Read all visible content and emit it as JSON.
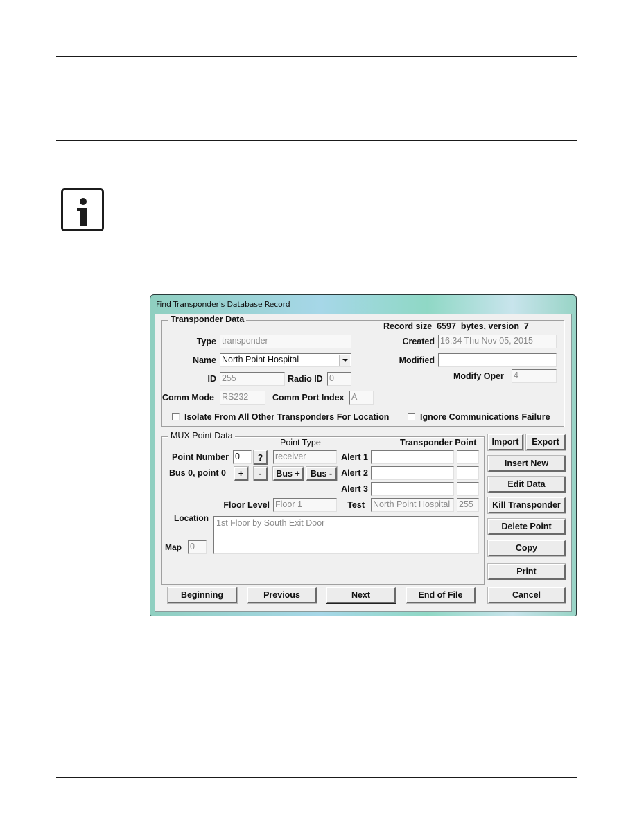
{
  "window": {
    "title": "Find Transponder's Database Record"
  },
  "transponder_data": {
    "group_title": "Transponder Data",
    "record_size_label": "Record size",
    "record_size_value": "6597",
    "bytes_version_label": "bytes, version",
    "version_value": "7",
    "type_label": "Type",
    "type_value": "transponder",
    "name_label": "Name",
    "name_value": "North Point Hospital",
    "id_label": "ID",
    "id_value": "255",
    "radio_id_label": "Radio ID",
    "radio_id_value": "0",
    "comm_mode_label": "Comm Mode",
    "comm_mode_value": "RS232",
    "comm_port_index_label": "Comm Port Index",
    "comm_port_index_value": "A",
    "created_label": "Created",
    "created_value": "16:34 Thu Nov 05, 2015",
    "modified_label": "Modified",
    "modified_value": "",
    "modify_oper_label": "Modify Oper",
    "modify_oper_value": "4",
    "isolate_checkbox_label": "Isolate From All Other Transponders For Location",
    "isolate_checked": false,
    "ignore_comm_checkbox_label": "Ignore Communications Failure",
    "ignore_comm_checked": false
  },
  "mux_point_data": {
    "group_title": "MUX Point Data",
    "point_type_header": "Point Type",
    "transponder_header": "Transponder",
    "point_header": "Point",
    "point_number_label": "Point Number",
    "point_number_value": "0",
    "help_button": "?",
    "point_type_value": "receiver",
    "bus_point_label": "Bus 0, point 0",
    "plus_button": "+",
    "minus_button": "-",
    "bus_plus_button": "Bus +",
    "bus_minus_button": "Bus -",
    "alerts": [
      {
        "label": "Alert 1",
        "transponder": "",
        "point": ""
      },
      {
        "label": "Alert 2",
        "transponder": "",
        "point": ""
      },
      {
        "label": "Alert 3",
        "transponder": "",
        "point": ""
      }
    ],
    "test_label": "Test",
    "test_transponder_value": "North Point Hospital",
    "test_point_value": "255",
    "floor_level_label": "Floor Level",
    "floor_level_value": "Floor 1",
    "location_label": "Location",
    "location_value": "1st Floor by South Exit Door",
    "map_label": "Map",
    "map_value": "0"
  },
  "side_buttons": {
    "import": "Import",
    "export": "Export",
    "insert_new": "Insert New",
    "edit_data": "Edit Data",
    "kill_transponder": "Kill Transponder",
    "delete_point": "Delete Point",
    "copy": "Copy",
    "print": "Print",
    "cancel": "Cancel"
  },
  "nav_buttons": {
    "beginning": "Beginning",
    "previous": "Previous",
    "next": "Next",
    "end_of_file": "End of File"
  },
  "note_icon": "info-icon"
}
